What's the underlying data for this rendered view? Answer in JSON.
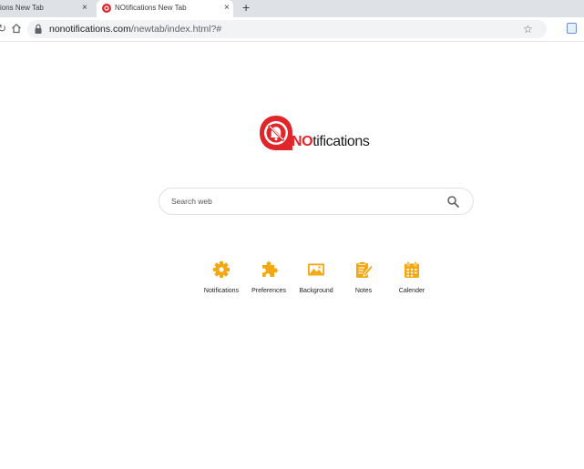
{
  "tabs": [
    {
      "label": "ions New Tab",
      "close": "×"
    },
    {
      "label": "NOtifications New Tab",
      "close": "×"
    }
  ],
  "new_tab": "+",
  "address_bar": {
    "domain": "nonotifications.com",
    "path": "/newtab/index.html?#"
  },
  "logo": {
    "prefix": "NO",
    "suffix": "tifications"
  },
  "search": {
    "placeholder": "Search web"
  },
  "shortcuts": [
    {
      "label": "Notifications",
      "icon": "gear-icon"
    },
    {
      "label": "Preferences",
      "icon": "puzzle-icon"
    },
    {
      "label": "Background",
      "icon": "image-icon"
    },
    {
      "label": "Notes",
      "icon": "notes-icon"
    },
    {
      "label": "Calender",
      "icon": "calendar-icon"
    }
  ],
  "colors": {
    "accent": "#f5a70f",
    "brand_red": "#e0262a"
  }
}
